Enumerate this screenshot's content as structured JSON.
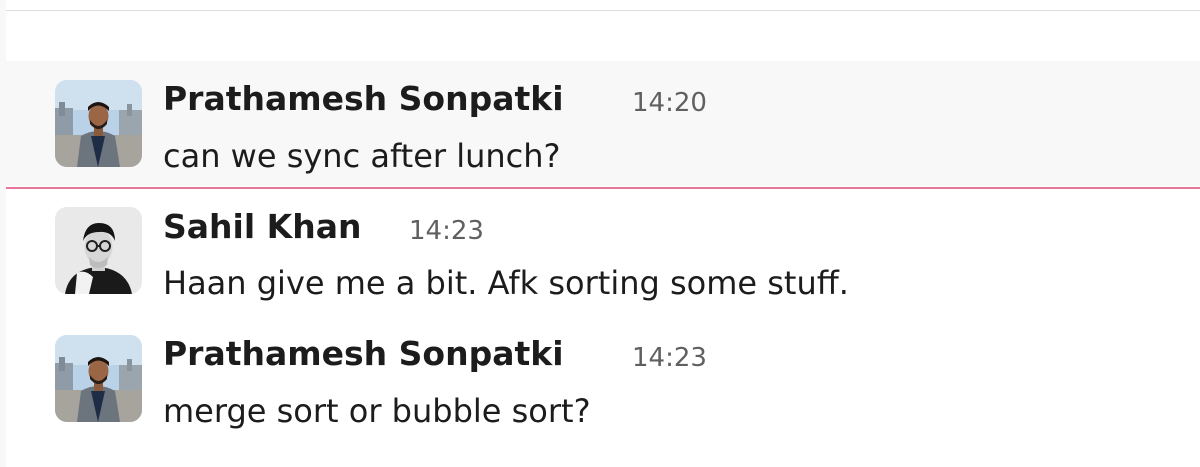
{
  "messages": [
    {
      "sender": "Prathamesh Sonpatki",
      "time": "14:20",
      "text": "can we sync after lunch?",
      "avatar": "outdoor-portrait-suit",
      "highlighted": true
    },
    {
      "sender": "Sahil Khan",
      "time": "14:23",
      "text": "Haan give me a bit. Afk sorting some stuff.",
      "avatar": "grayscale-portrait-glasses",
      "highlighted": false
    },
    {
      "sender": "Prathamesh Sonpatki",
      "time": "14:23",
      "text": "merge sort or bubble sort?",
      "avatar": "outdoor-portrait-suit",
      "highlighted": false
    }
  ],
  "colors": {
    "highlight_bg": "#f8f8f8",
    "new_message_divider": "#e8779a",
    "sender_text": "#1d1c1d",
    "timestamp_text": "#616061"
  }
}
